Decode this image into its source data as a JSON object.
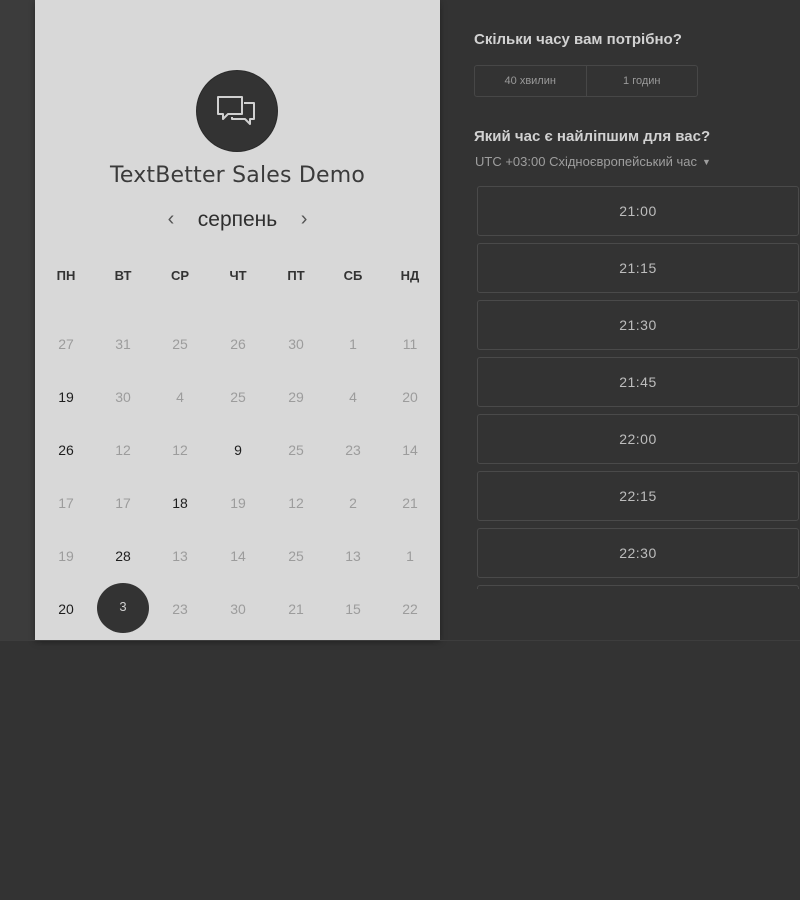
{
  "calendar": {
    "title": "TextBetter Sales Demo",
    "month": "серпень",
    "prev_arrow": "‹",
    "next_arrow": "›",
    "weekdays": [
      "ПН",
      "ВТ",
      "СР",
      "ЧТ",
      "ПТ",
      "СБ",
      "НД"
    ],
    "weeks": [
      [
        {
          "d": "27",
          "active": false
        },
        {
          "d": "31",
          "active": false
        },
        {
          "d": "25",
          "active": false
        },
        {
          "d": "26",
          "active": false
        },
        {
          "d": "30",
          "active": false
        },
        {
          "d": "1",
          "active": false
        },
        {
          "d": "11",
          "active": false
        }
      ],
      [
        {
          "d": "19",
          "active": true
        },
        {
          "d": "30",
          "active": false
        },
        {
          "d": "4",
          "active": false
        },
        {
          "d": "25",
          "active": false
        },
        {
          "d": "29",
          "active": false
        },
        {
          "d": "4",
          "active": false
        },
        {
          "d": "20",
          "active": false
        }
      ],
      [
        {
          "d": "26",
          "active": true
        },
        {
          "d": "12",
          "active": false
        },
        {
          "d": "12",
          "active": false
        },
        {
          "d": "9",
          "active": true
        },
        {
          "d": "25",
          "active": false
        },
        {
          "d": "23",
          "active": false
        },
        {
          "d": "14",
          "active": false
        }
      ],
      [
        {
          "d": "17",
          "active": false
        },
        {
          "d": "17",
          "active": false
        },
        {
          "d": "18",
          "active": true
        },
        {
          "d": "19",
          "active": false
        },
        {
          "d": "12",
          "active": false
        },
        {
          "d": "2",
          "active": false
        },
        {
          "d": "21",
          "active": false
        }
      ],
      [
        {
          "d": "19",
          "active": false
        },
        {
          "d": "28",
          "active": true
        },
        {
          "d": "13",
          "active": false
        },
        {
          "d": "14",
          "active": false
        },
        {
          "d": "25",
          "active": false
        },
        {
          "d": "13",
          "active": false
        },
        {
          "d": "1",
          "active": false
        }
      ],
      [
        {
          "d": "20",
          "active": true
        },
        {
          "d": "3",
          "active": true,
          "selected": true
        },
        {
          "d": "23",
          "active": false
        },
        {
          "d": "30",
          "active": false
        },
        {
          "d": "21",
          "active": false
        },
        {
          "d": "15",
          "active": false
        },
        {
          "d": "22",
          "active": false
        }
      ]
    ]
  },
  "duration": {
    "question": "Скільки часу вам потрібно?",
    "options": [
      "40 хвилин",
      "1 годин"
    ]
  },
  "time": {
    "question": "Який час є найліпшим для вас?",
    "timezone": "UTC +03:00 Східноєвропейський час",
    "slots": [
      "21:00",
      "21:15",
      "21:30",
      "21:45",
      "22:00",
      "22:15",
      "22:30",
      ""
    ]
  },
  "colors": {
    "background": "#333333",
    "card": "#d8d8d8",
    "selected_day": "#333333"
  },
  "icons": {
    "logo": "chat-bubbles-icon",
    "timezone_caret": "caret-down-icon"
  }
}
